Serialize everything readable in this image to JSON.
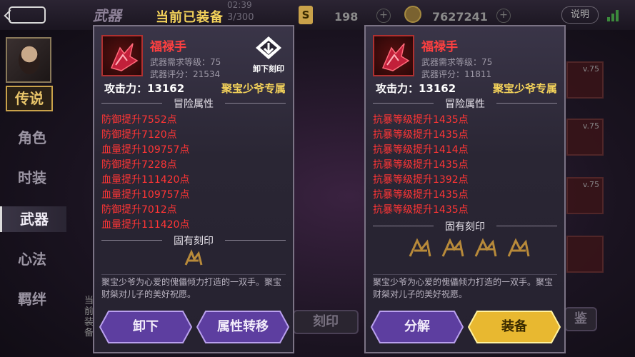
{
  "top": {
    "title": "武器",
    "time": "02:39",
    "count": "3/300",
    "coin_symbol": "S",
    "val1": "198",
    "val2": "7627241",
    "help": "说明"
  },
  "header_title": "当前已装备",
  "nav": {
    "legend": "传说",
    "items": [
      "角色",
      "时装",
      "武器",
      "心法",
      "羁绊"
    ],
    "active": "武器"
  },
  "behind": {
    "slot_levels": [
      "v.75",
      "v.75",
      "v.75"
    ],
    "btn_engrave": "刻印",
    "btn_appraise": "鉴",
    "left_text": [
      "当",
      "前",
      "装",
      "备"
    ]
  },
  "left_panel": {
    "name": "福禄手",
    "req_label": "武器需求等级：",
    "req": "75",
    "score_label": "武器评分：",
    "score": "21534",
    "unload_label": "卸下刻印",
    "atk": "攻击力：13162",
    "exclusive": "聚宝少爷专属",
    "adv_head": "冒险属性",
    "attrs": [
      "防御提升7552点",
      "防御提升7120点",
      "血量提升109757点",
      "防御提升7228点",
      "血量提升111420点",
      "血量提升109757点",
      "防御提升7012点",
      "血量提升111420点"
    ],
    "inscr_head": "固有刻印",
    "desc": "聚宝少爷为心爱的傀儡倾力打造的一双手。聚宝财桀对儿子的美好祝愿。",
    "btn1": "卸下",
    "btn2": "属性转移"
  },
  "right_panel": {
    "name": "福禄手",
    "req_label": "武器需求等级：",
    "req": "75",
    "score_label": "武器评分：",
    "score": "11811",
    "atk": "攻击力：13162",
    "exclusive": "聚宝少爷专属",
    "adv_head": "冒险属性",
    "attrs": [
      "抗暴等级提升1435点",
      "抗暴等级提升1435点",
      "抗暴等级提升1414点",
      "抗暴等级提升1435点",
      "抗暴等级提升1392点",
      "抗暴等级提升1435点",
      "抗暴等级提升1435点"
    ],
    "inscr_head": "固有刻印",
    "desc": "聚宝少爷为心爱的傀儡倾力打造的一双手。聚宝财桀对儿子的美好祝愿。",
    "btn1": "分解",
    "btn2": "装备"
  },
  "colors": {
    "attr_red": "#ff3535",
    "gold": "#f3d25a",
    "name_red": "#ff4040"
  }
}
